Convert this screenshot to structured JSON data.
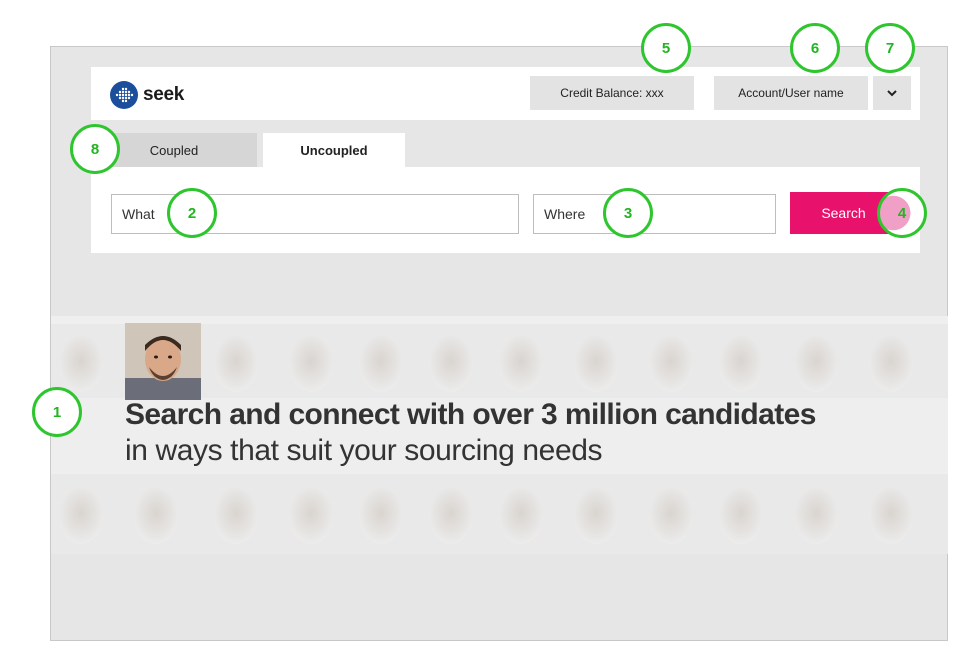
{
  "header": {
    "logo_text": "seek",
    "credit_balance": "Credit Balance: xxx",
    "account_label": "Account/User name"
  },
  "tabs": [
    {
      "label": "Coupled",
      "active": false
    },
    {
      "label": "Uncoupled",
      "active": true
    }
  ],
  "search": {
    "what_placeholder": "What",
    "where_placeholder": "Where",
    "button_label": "Search"
  },
  "hero": {
    "headline": "Search and connect with over 3 million candidates",
    "subline": "in ways that suit your sourcing needs"
  },
  "callouts": [
    "1",
    "2",
    "3",
    "4",
    "5",
    "6",
    "7",
    "8"
  ],
  "colors": {
    "accent": "#e8116b",
    "callout_green": "#2ec52e",
    "background": "#e6e6e6",
    "logo_blue": "#1b4f9c"
  }
}
